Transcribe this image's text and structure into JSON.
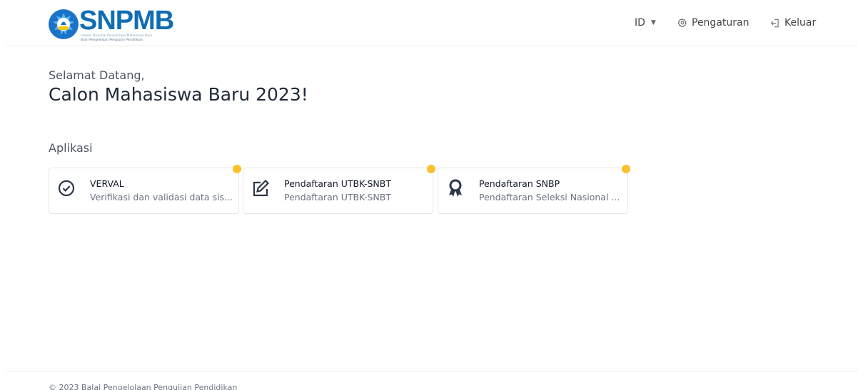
{
  "header": {
    "logo": {
      "text": "SNPMB",
      "subtitle_line1": "Seleksi Nasional Penerimaan Mahasiswa Baru",
      "subtitle_line2": "Balai Pengelolaan Pengujian Pendidikan",
      "brand_color": "#0f6db3",
      "icon": "tut-wuri-handayani-emblem"
    },
    "nav": {
      "language": {
        "label": "ID",
        "icon": "caret-down-icon"
      },
      "settings": {
        "label": "Pengaturan",
        "icon": "gear-icon"
      },
      "logout": {
        "label": "Keluar",
        "icon": "logout-icon"
      }
    }
  },
  "welcome": {
    "greeting": "Selamat Datang,",
    "headline": "Calon Mahasiswa Baru 2023!"
  },
  "apps": {
    "section_title": "Aplikasi",
    "badge_color": "#fbc02d",
    "items": [
      {
        "title": "VERVAL",
        "description": "Verifikasi dan validasi data sis...",
        "icon": "check-circle-icon"
      },
      {
        "title": "Pendaftaran UTBK-SNBT",
        "description": "Pendaftaran UTBK-SNBT",
        "icon": "edit-icon"
      },
      {
        "title": "Pendaftaran SNBP",
        "description": "Pendaftaran Seleksi Nasional ...",
        "icon": "award-icon"
      }
    ]
  },
  "footer": {
    "copyright": "© 2023 Balai Pengelolaan Pengujian Pendidikan"
  }
}
